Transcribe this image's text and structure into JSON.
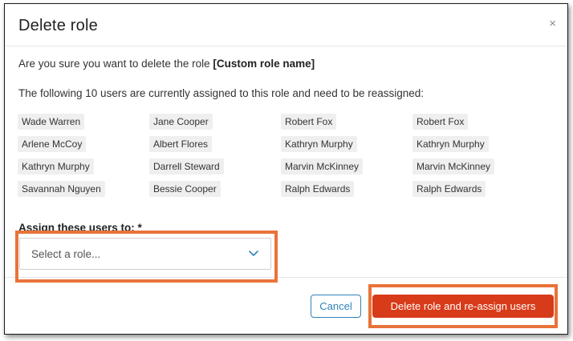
{
  "dialog": {
    "title": "Delete role",
    "close_symbol": "×",
    "confirm_prefix": "Are you sure you want to delete the role ",
    "role_name": "[Custom role name]",
    "users_message": "The following 10 users are currently assigned to this role and need to be reassigned:"
  },
  "users": [
    "Wade Warren",
    "Jane Cooper",
    "Robert Fox",
    "Robert Fox",
    "Arlene McCoy",
    "Albert Flores",
    "Kathryn Murphy",
    "Kathryn Murphy",
    "Kathryn Murphy",
    "Darrell Steward",
    "Marvin McKinney",
    "Marvin McKinney",
    "Savannah Nguyen",
    "Bessie Cooper",
    "Ralph Edwards",
    "Ralph Edwards"
  ],
  "assign": {
    "label": "Assign these users to: *",
    "placeholder": "Select a role..."
  },
  "actions": {
    "cancel_label": "Cancel",
    "delete_label": "Delete role and re-assign users"
  },
  "colors": {
    "primary_blue": "#2e84b7",
    "danger_red": "#d83b1a",
    "highlight_orange": "#e8733a"
  },
  "icons": {
    "close": "close-icon",
    "dropdown": "chevron-down-icon"
  }
}
